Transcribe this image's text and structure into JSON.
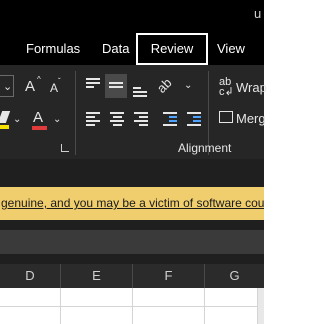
{
  "window": {
    "title_fragment": "u"
  },
  "tabs": [
    {
      "label": "Formulas"
    },
    {
      "label": "Data"
    },
    {
      "label": "Review",
      "selected": true
    },
    {
      "label": "View"
    }
  ],
  "ribbon": {
    "font_group": {
      "increase_font_glyph": "A",
      "decrease_font_glyph": "A",
      "font_color_glyph": "A",
      "dropdown_glyph": "⌄"
    },
    "alignment_group": {
      "label": "Alignment",
      "wrap_text_label": "Wrap",
      "merge_label": "Merg",
      "orientation_glyph": "ab"
    }
  },
  "warning_bar": {
    "message": "genuine, and you may be a victim of software cou"
  },
  "columns": [
    "D",
    "E",
    "F",
    "G"
  ],
  "colors": {
    "title_bg": "#000000",
    "ribbon_bg": "#262626",
    "warning_bg": "#f0ce6e",
    "selected_tab_border": "#ffffff",
    "font_color_underline": "#e03b3b",
    "highlight_color": "#f5e000"
  }
}
